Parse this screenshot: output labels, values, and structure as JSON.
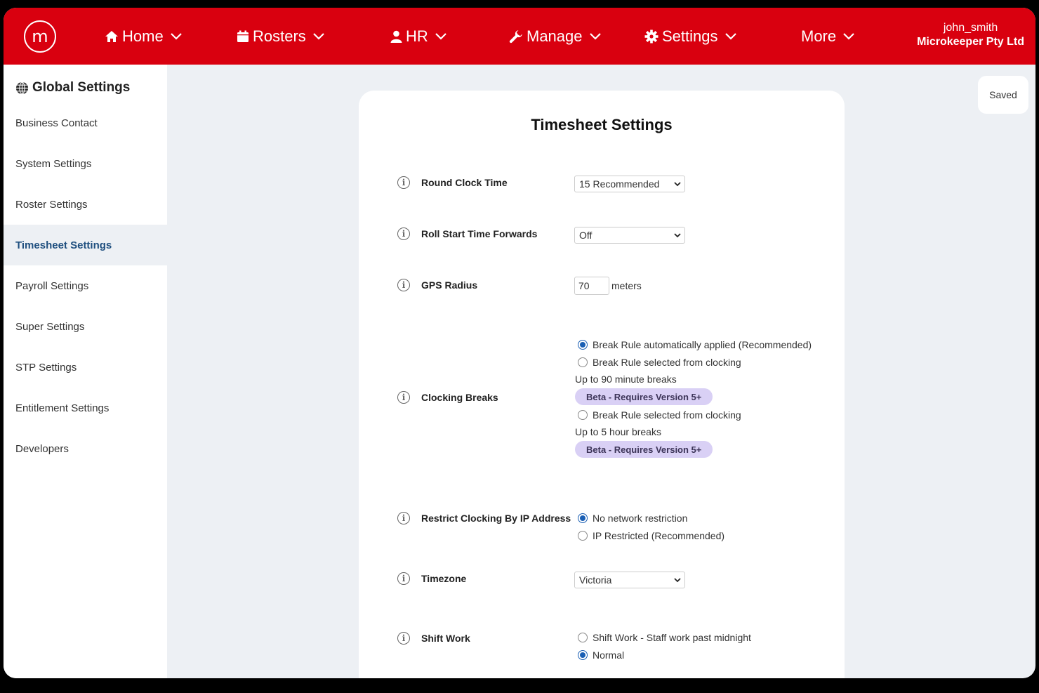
{
  "nav": {
    "items": [
      {
        "label": "Home",
        "icon": "home-icon"
      },
      {
        "label": "Rosters",
        "icon": "calendar-icon"
      },
      {
        "label": "HR",
        "icon": "user-icon"
      },
      {
        "label": "Manage",
        "icon": "wrench-icon"
      },
      {
        "label": "Settings",
        "icon": "gear-icon"
      },
      {
        "label": "More",
        "icon": ""
      }
    ],
    "user": {
      "username": "john_smith",
      "company": "Microkeeper Pty Ltd"
    },
    "brand_color": "#d9000f"
  },
  "sidebar": {
    "heading": "Global Settings",
    "items": [
      {
        "label": "Business Contact"
      },
      {
        "label": "System Settings"
      },
      {
        "label": "Roster Settings"
      },
      {
        "label": "Timesheet Settings",
        "active": true
      },
      {
        "label": "Payroll Settings"
      },
      {
        "label": "Super Settings"
      },
      {
        "label": "STP Settings"
      },
      {
        "label": "Entitlement Settings"
      },
      {
        "label": "Developers"
      }
    ]
  },
  "toast": {
    "text": "Saved"
  },
  "card": {
    "title": "Timesheet Settings",
    "round_clock": {
      "label": "Round Clock Time",
      "value": "15 Recommended"
    },
    "roll_start": {
      "label": "Roll Start Time Forwards",
      "value": "Off"
    },
    "gps": {
      "label": "GPS Radius",
      "value": "70",
      "unit": "meters"
    },
    "clocking_breaks": {
      "label": "Clocking Breaks",
      "options": [
        {
          "label": "Break Rule automatically applied (Recommended)",
          "selected": true
        },
        {
          "label": "Break Rule selected from clocking",
          "note": "Up to 90 minute breaks",
          "badge": "Beta - Requires Version 5+",
          "selected": false
        },
        {
          "label": "Break Rule selected from clocking",
          "note": "Up to 5 hour breaks",
          "badge": "Beta - Requires Version 5+",
          "selected": false
        }
      ]
    },
    "ip_restrict": {
      "label": "Restrict Clocking By IP Address",
      "options": [
        {
          "label": "No network restriction",
          "selected": true
        },
        {
          "label": "IP Restricted (Recommended)",
          "selected": false
        }
      ]
    },
    "timezone": {
      "label": "Timezone",
      "value": "Victoria"
    },
    "shift_work": {
      "label": "Shift Work",
      "options": [
        {
          "label": "Shift Work - Staff work past midnight",
          "selected": false
        },
        {
          "label": "Normal",
          "selected": true
        }
      ]
    }
  }
}
